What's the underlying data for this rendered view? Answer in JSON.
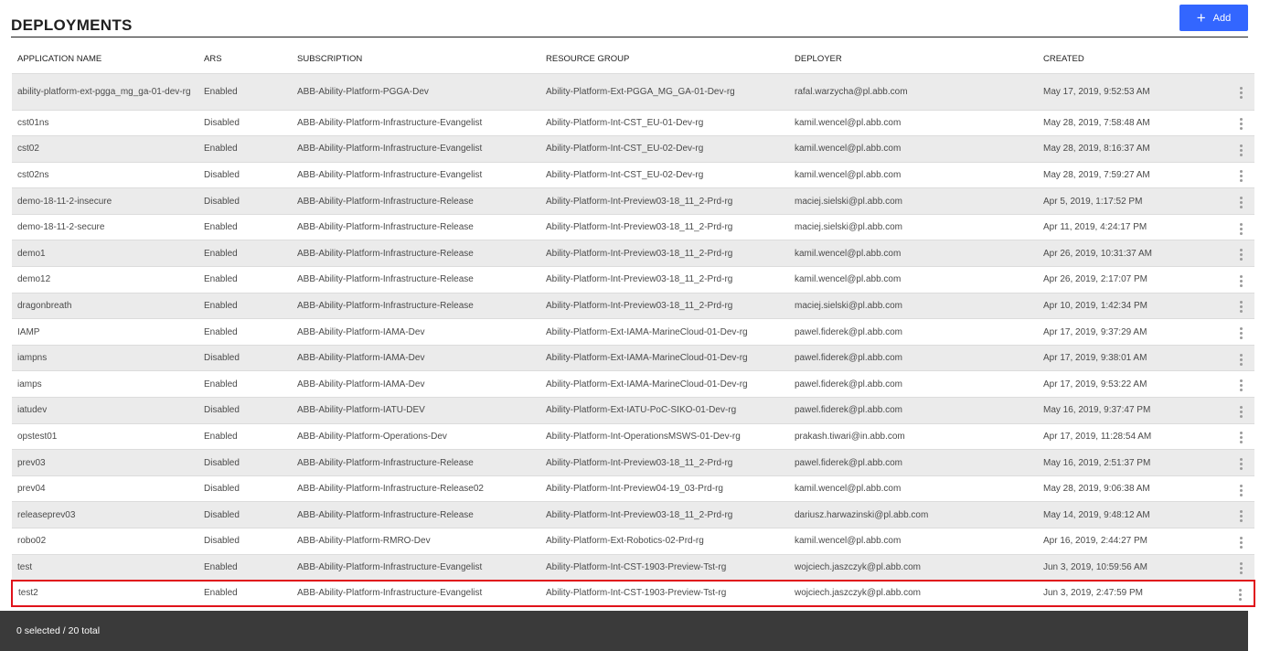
{
  "page": {
    "title": "DEPLOYMENTS",
    "add_button_label": "Add",
    "add_button_icon": "plus-icon",
    "accent_color": "#3366ff",
    "highlight_color": "#e0121a"
  },
  "table": {
    "columns": [
      "APPLICATION NAME",
      "ARS",
      "SUBSCRIPTION",
      "RESOURCE GROUP",
      "DEPLOYER",
      "CREATED"
    ],
    "rows": [
      {
        "name": "ability-platform-ext-pgga_mg_ga-01-dev-rg",
        "ars": "Enabled",
        "subscription": "ABB-Ability-Platform-PGGA-Dev",
        "resource_group": "Ability-Platform-Ext-PGGA_MG_GA-01-Dev-rg",
        "deployer": "rafal.warzycha@pl.abb.com",
        "created": "May 17, 2019, 9:52:53 AM"
      },
      {
        "name": "cst01ns",
        "ars": "Disabled",
        "subscription": "ABB-Ability-Platform-Infrastructure-Evangelist",
        "resource_group": "Ability-Platform-Int-CST_EU-01-Dev-rg",
        "deployer": "kamil.wencel@pl.abb.com",
        "created": "May 28, 2019, 7:58:48 AM"
      },
      {
        "name": "cst02",
        "ars": "Enabled",
        "subscription": "ABB-Ability-Platform-Infrastructure-Evangelist",
        "resource_group": "Ability-Platform-Int-CST_EU-02-Dev-rg",
        "deployer": "kamil.wencel@pl.abb.com",
        "created": "May 28, 2019, 8:16:37 AM"
      },
      {
        "name": "cst02ns",
        "ars": "Disabled",
        "subscription": "ABB-Ability-Platform-Infrastructure-Evangelist",
        "resource_group": "Ability-Platform-Int-CST_EU-02-Dev-rg",
        "deployer": "kamil.wencel@pl.abb.com",
        "created": "May 28, 2019, 7:59:27 AM"
      },
      {
        "name": "demo-18-11-2-insecure",
        "ars": "Disabled",
        "subscription": "ABB-Ability-Platform-Infrastructure-Release",
        "resource_group": "Ability-Platform-Int-Preview03-18_11_2-Prd-rg",
        "deployer": "maciej.sielski@pl.abb.com",
        "created": "Apr 5, 2019, 1:17:52 PM"
      },
      {
        "name": "demo-18-11-2-secure",
        "ars": "Enabled",
        "subscription": "ABB-Ability-Platform-Infrastructure-Release",
        "resource_group": "Ability-Platform-Int-Preview03-18_11_2-Prd-rg",
        "deployer": "maciej.sielski@pl.abb.com",
        "created": "Apr 11, 2019, 4:24:17 PM"
      },
      {
        "name": "demo1",
        "ars": "Enabled",
        "subscription": "ABB-Ability-Platform-Infrastructure-Release",
        "resource_group": "Ability-Platform-Int-Preview03-18_11_2-Prd-rg",
        "deployer": "kamil.wencel@pl.abb.com",
        "created": "Apr 26, 2019, 10:31:37 AM"
      },
      {
        "name": "demo12",
        "ars": "Enabled",
        "subscription": "ABB-Ability-Platform-Infrastructure-Release",
        "resource_group": "Ability-Platform-Int-Preview03-18_11_2-Prd-rg",
        "deployer": "kamil.wencel@pl.abb.com",
        "created": "Apr 26, 2019, 2:17:07 PM"
      },
      {
        "name": "dragonbreath",
        "ars": "Enabled",
        "subscription": "ABB-Ability-Platform-Infrastructure-Release",
        "resource_group": "Ability-Platform-Int-Preview03-18_11_2-Prd-rg",
        "deployer": "maciej.sielski@pl.abb.com",
        "created": "Apr 10, 2019, 1:42:34 PM"
      },
      {
        "name": "IAMP",
        "ars": "Enabled",
        "subscription": "ABB-Ability-Platform-IAMA-Dev",
        "resource_group": "Ability-Platform-Ext-IAMA-MarineCloud-01-Dev-rg",
        "deployer": "pawel.fiderek@pl.abb.com",
        "created": "Apr 17, 2019, 9:37:29 AM"
      },
      {
        "name": "iampns",
        "ars": "Disabled",
        "subscription": "ABB-Ability-Platform-IAMA-Dev",
        "resource_group": "Ability-Platform-Ext-IAMA-MarineCloud-01-Dev-rg",
        "deployer": "pawel.fiderek@pl.abb.com",
        "created": "Apr 17, 2019, 9:38:01 AM"
      },
      {
        "name": "iamps",
        "ars": "Enabled",
        "subscription": "ABB-Ability-Platform-IAMA-Dev",
        "resource_group": "Ability-Platform-Ext-IAMA-MarineCloud-01-Dev-rg",
        "deployer": "pawel.fiderek@pl.abb.com",
        "created": "Apr 17, 2019, 9:53:22 AM"
      },
      {
        "name": "iatudev",
        "ars": "Disabled",
        "subscription": "ABB-Ability-Platform-IATU-DEV",
        "resource_group": "Ability-Platform-Ext-IATU-PoC-SIKO-01-Dev-rg",
        "deployer": "pawel.fiderek@pl.abb.com",
        "created": "May 16, 2019, 9:37:47 PM"
      },
      {
        "name": "opstest01",
        "ars": "Enabled",
        "subscription": "ABB-Ability-Platform-Operations-Dev",
        "resource_group": "Ability-Platform-Int-OperationsMSWS-01-Dev-rg",
        "deployer": "prakash.tiwari@in.abb.com",
        "created": "Apr 17, 2019, 11:28:54 AM"
      },
      {
        "name": "prev03",
        "ars": "Disabled",
        "subscription": "ABB-Ability-Platform-Infrastructure-Release",
        "resource_group": "Ability-Platform-Int-Preview03-18_11_2-Prd-rg",
        "deployer": "pawel.fiderek@pl.abb.com",
        "created": "May 16, 2019, 2:51:37 PM"
      },
      {
        "name": "prev04",
        "ars": "Disabled",
        "subscription": "ABB-Ability-Platform-Infrastructure-Release02",
        "resource_group": "Ability-Platform-Int-Preview04-19_03-Prd-rg",
        "deployer": "kamil.wencel@pl.abb.com",
        "created": "May 28, 2019, 9:06:38 AM"
      },
      {
        "name": "releaseprev03",
        "ars": "Disabled",
        "subscription": "ABB-Ability-Platform-Infrastructure-Release",
        "resource_group": "Ability-Platform-Int-Preview03-18_11_2-Prd-rg",
        "deployer": "dariusz.harwazinski@pl.abb.com",
        "created": "May 14, 2019, 9:48:12 AM"
      },
      {
        "name": "robo02",
        "ars": "Disabled",
        "subscription": "ABB-Ability-Platform-RMRO-Dev",
        "resource_group": "Ability-Platform-Ext-Robotics-02-Prd-rg",
        "deployer": "kamil.wencel@pl.abb.com",
        "created": "Apr 16, 2019, 2:44:27 PM"
      },
      {
        "name": "test",
        "ars": "Enabled",
        "subscription": "ABB-Ability-Platform-Infrastructure-Evangelist",
        "resource_group": "Ability-Platform-Int-CST-1903-Preview-Tst-rg",
        "deployer": "wojciech.jaszczyk@pl.abb.com",
        "created": "Jun 3, 2019, 10:59:56 AM"
      },
      {
        "name": "test2",
        "ars": "Enabled",
        "subscription": "ABB-Ability-Platform-Infrastructure-Evangelist",
        "resource_group": "Ability-Platform-Int-CST-1903-Preview-Tst-rg",
        "deployer": "wojciech.jaszczyk@pl.abb.com",
        "created": "Jun 3, 2019, 2:47:59 PM"
      }
    ],
    "highlighted_row": 19,
    "row_menu_icon": "kebab-menu-icon"
  },
  "footer": {
    "selection_text": "0 selected / 20 total"
  }
}
